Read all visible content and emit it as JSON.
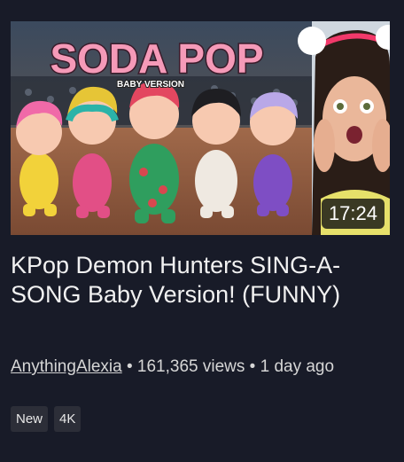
{
  "video": {
    "thumbnail_text": "SODA POP",
    "thumbnail_subtext": "BABY VERSION",
    "duration": "17:24",
    "title": "KPop Demon Hunters SING-A-SONG Baby Version! (FUNNY)",
    "channel": "AnythingAlexia",
    "views": "161,365 views",
    "separator": "•",
    "age": "1 day ago",
    "badges": [
      "New",
      "4K"
    ]
  },
  "colors": {
    "background": "#181b28",
    "title_pink": "#f59ab8",
    "badge_bg": "#2c2e38"
  }
}
